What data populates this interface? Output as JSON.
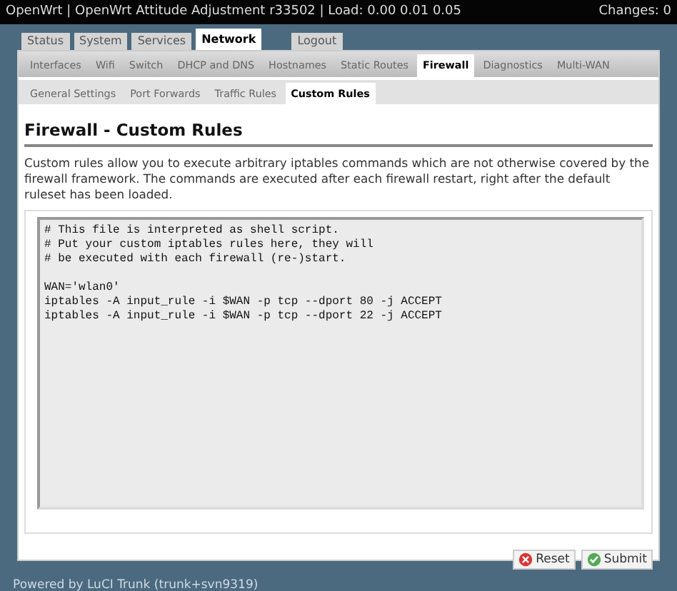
{
  "header": {
    "title": "OpenWrt | OpenWrt Attitude Adjustment r33502 | Load: 0.00 0.01 0.05",
    "changes": "Changes: 0"
  },
  "main_tabs": [
    {
      "label": "Status",
      "selected": false
    },
    {
      "label": "System",
      "selected": false
    },
    {
      "label": "Services",
      "selected": false
    },
    {
      "label": "Network",
      "selected": true
    }
  ],
  "logout_tab": {
    "label": "Logout",
    "selected": false
  },
  "sub_tabs": [
    {
      "label": "Interfaces",
      "selected": false
    },
    {
      "label": "Wifi",
      "selected": false
    },
    {
      "label": "Switch",
      "selected": false
    },
    {
      "label": "DHCP and DNS",
      "selected": false
    },
    {
      "label": "Hostnames",
      "selected": false
    },
    {
      "label": "Static Routes",
      "selected": false
    },
    {
      "label": "Firewall",
      "selected": true
    },
    {
      "label": "Diagnostics",
      "selected": false
    },
    {
      "label": "Multi-WAN",
      "selected": false
    }
  ],
  "firewall_tabs": [
    {
      "label": "General Settings",
      "selected": false
    },
    {
      "label": "Port Forwards",
      "selected": false
    },
    {
      "label": "Traffic Rules",
      "selected": false
    },
    {
      "label": "Custom Rules",
      "selected": true
    }
  ],
  "page": {
    "title": "Firewall - Custom Rules",
    "description": "Custom rules allow you to execute arbitrary iptables commands which are not otherwise covered by the firewall framework. The commands are executed after each firewall restart, right after the default ruleset has been loaded.",
    "script": "# This file is interpreted as shell script.\n# Put your custom iptables rules here, they will\n# be executed with each firewall (re-)start.\n\nWAN='wlan0'\niptables -A input_rule -i $WAN -p tcp --dport 80 -j ACCEPT\niptables -A input_rule -i $WAN -p tcp --dport 22 -j ACCEPT"
  },
  "buttons": [
    {
      "label": "Reset",
      "kind": "reset"
    },
    {
      "label": "Submit",
      "kind": "submit"
    }
  ],
  "footer": "Powered by LuCI Trunk (trunk+svn9319)"
}
